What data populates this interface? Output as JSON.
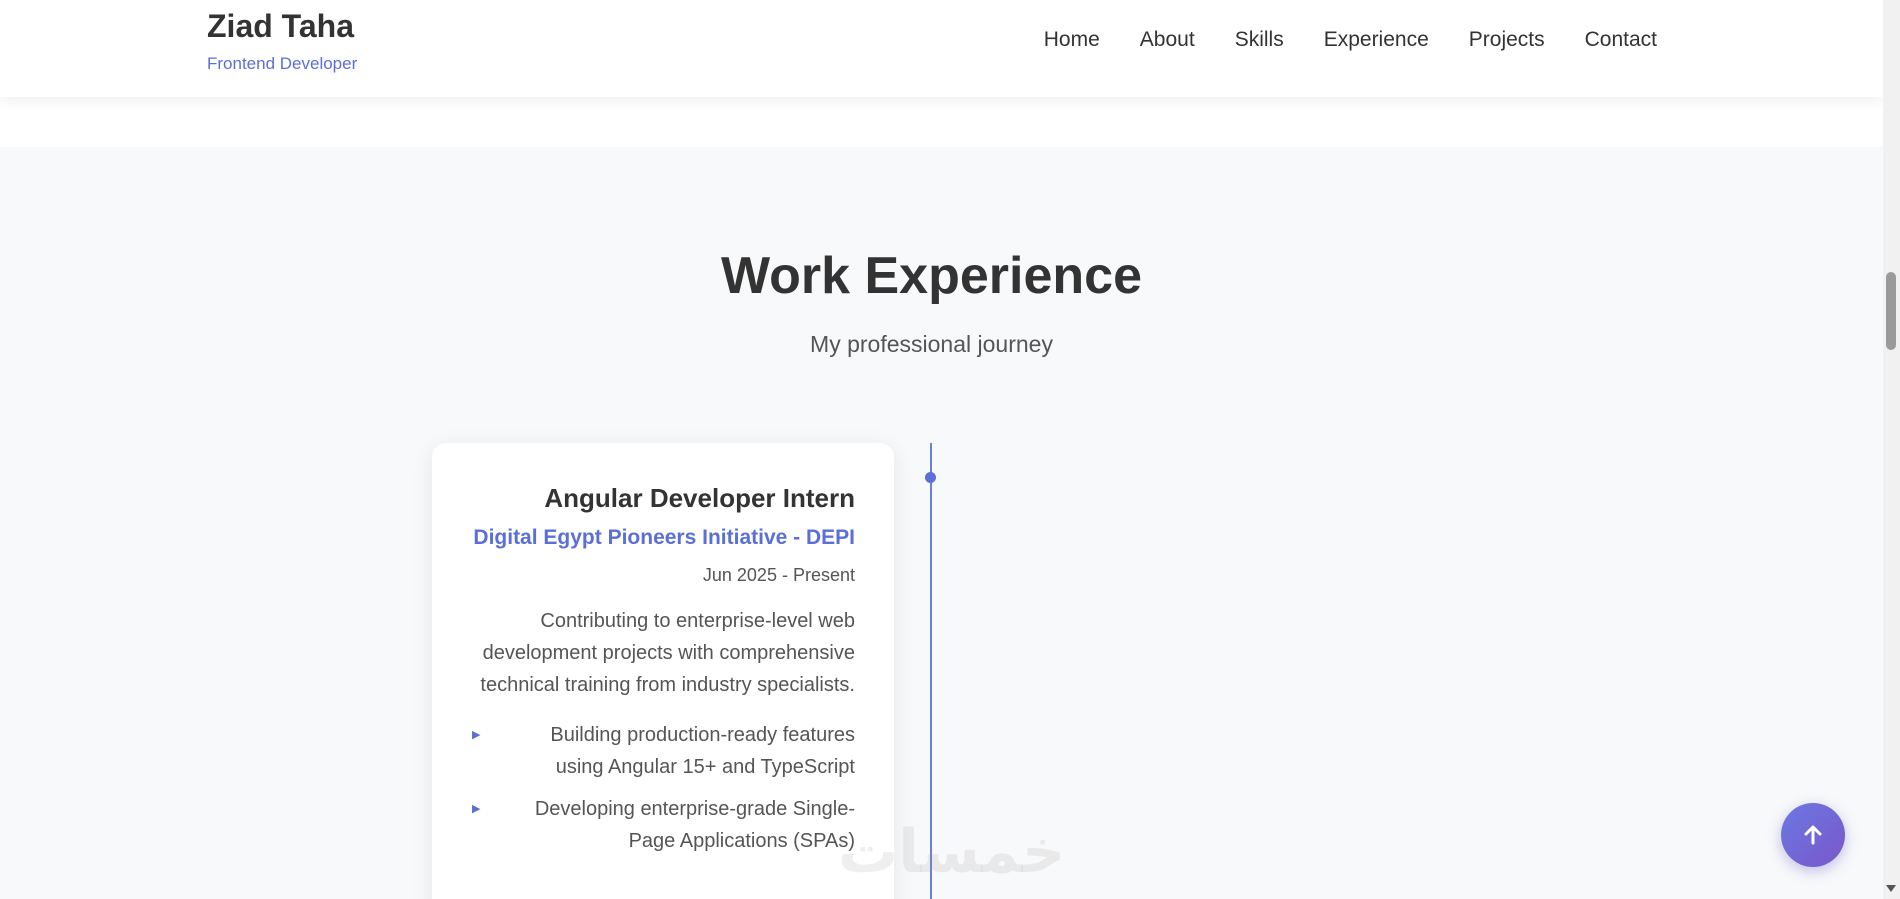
{
  "header": {
    "brand_name": "Ziad Taha",
    "brand_subtitle": "Frontend Developer",
    "nav_links": [
      "Home",
      "About",
      "Skills",
      "Experience",
      "Projects",
      "Contact"
    ]
  },
  "experience_section": {
    "title": "Work Experience",
    "subtitle": "My professional journey",
    "items": [
      {
        "title": "Angular Developer Intern",
        "company": "Digital Egypt Pioneers Initiative - DEPI",
        "dates": "Jun 2025 - Present",
        "description": "Contributing to enterprise-level web development projects with comprehensive technical training from industry specialists.",
        "highlights": [
          "Building production-ready features using Angular 15+ and TypeScript",
          "Developing enterprise-grade Single-Page Applications (SPAs)"
        ]
      }
    ]
  },
  "watermark_text": "خمسات",
  "icons": {
    "scroll_top": "arrow-up-icon",
    "highlight_bullet": "triangle-right-icon"
  },
  "colors": {
    "accent": "#5b6fd8",
    "scroll_top_gradient_start": "#6b78e3",
    "scroll_top_gradient_end": "#7a57c9",
    "section_background": "#f8f9fa"
  }
}
